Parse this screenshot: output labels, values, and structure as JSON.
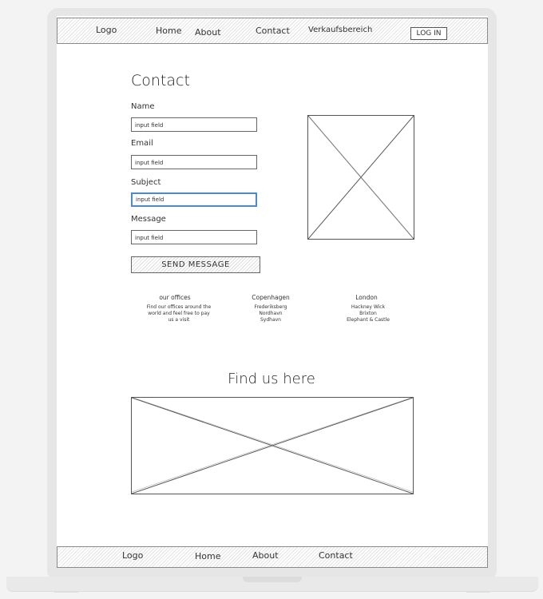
{
  "header": {
    "logo": "Logo",
    "nav": [
      "Home",
      "About",
      "Contact",
      "Verkaufsbereich"
    ],
    "login": "LOG IN"
  },
  "contact": {
    "title": "Contact",
    "fields": [
      {
        "label": "Name",
        "value": "input field"
      },
      {
        "label": "Email",
        "value": "input field"
      },
      {
        "label": "Subject",
        "value": "input field"
      },
      {
        "label": "Message",
        "value": "input field"
      }
    ],
    "send": "SEND MESSAGE"
  },
  "offices": {
    "heading": "our offices",
    "text": [
      "Find our offices around the",
      "world and feel free to pay",
      "us a visit"
    ],
    "copenhagen": {
      "heading": "Copenhagen",
      "lines": [
        "Frederiksberg",
        "Nordhavn",
        "Sydhavn"
      ]
    },
    "london": {
      "heading": "London",
      "lines": [
        "Hackney Wick",
        "Brixton",
        "Elephant & Castle"
      ]
    }
  },
  "map": {
    "title": "Find us here"
  },
  "footer": {
    "logo": "Logo",
    "nav": [
      "Home",
      "About",
      "Contact"
    ]
  }
}
